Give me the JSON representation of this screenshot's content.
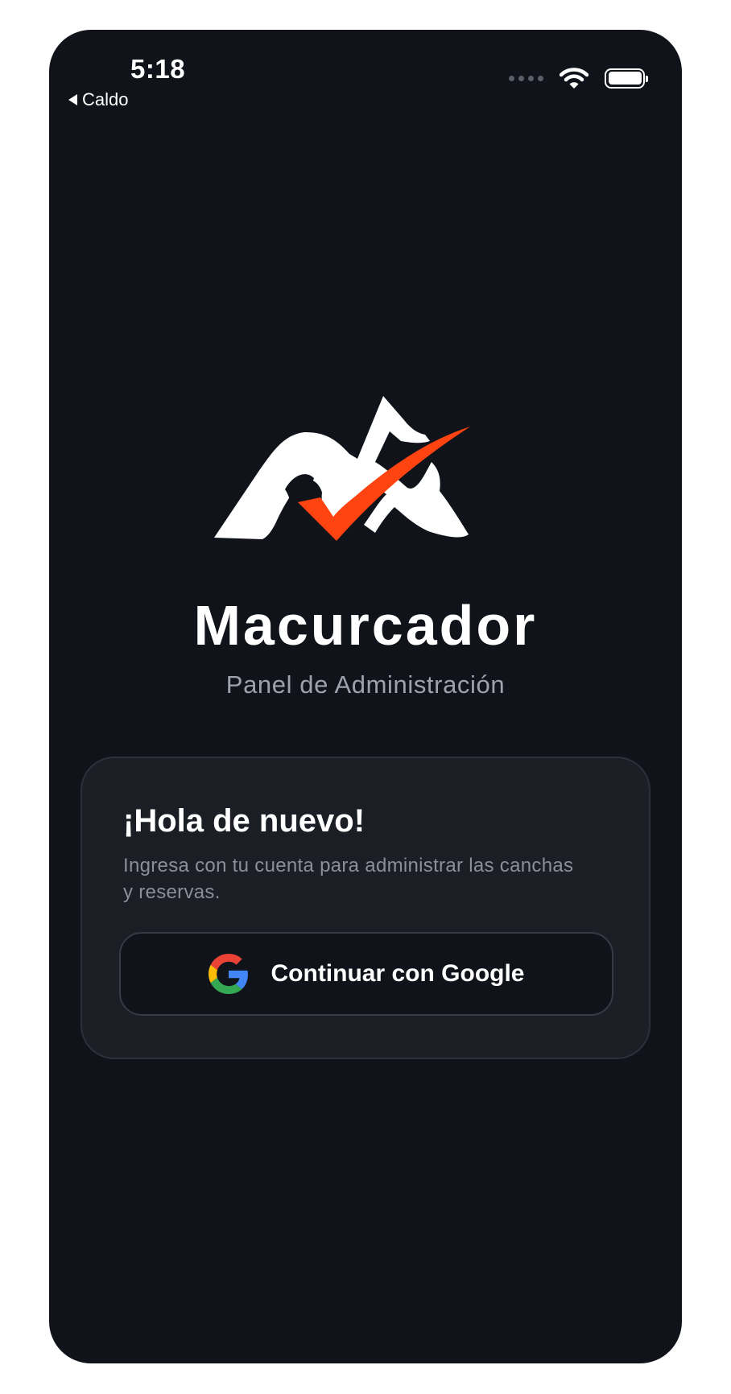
{
  "status_bar": {
    "time": "5:18",
    "back_app": "Caldo",
    "icons": [
      "back-caret-icon",
      "signal-dots-icon",
      "wifi-icon",
      "battery-icon"
    ]
  },
  "brand": {
    "name": "Macurcador",
    "subtitle": "Panel de Administración",
    "logo_colors": {
      "primary": "#ffffff",
      "accent": "#ff4411"
    }
  },
  "login_card": {
    "title": "¡Hola de nuevo!",
    "description": "Ingresa con tu cuenta para administrar las canchas y reservas.",
    "google_button_label": "Continuar con Google",
    "google_icon": "google-icon"
  },
  "colors": {
    "background": "#10131a",
    "card": "#1b1e25",
    "muted_text": "#8a8f99"
  }
}
